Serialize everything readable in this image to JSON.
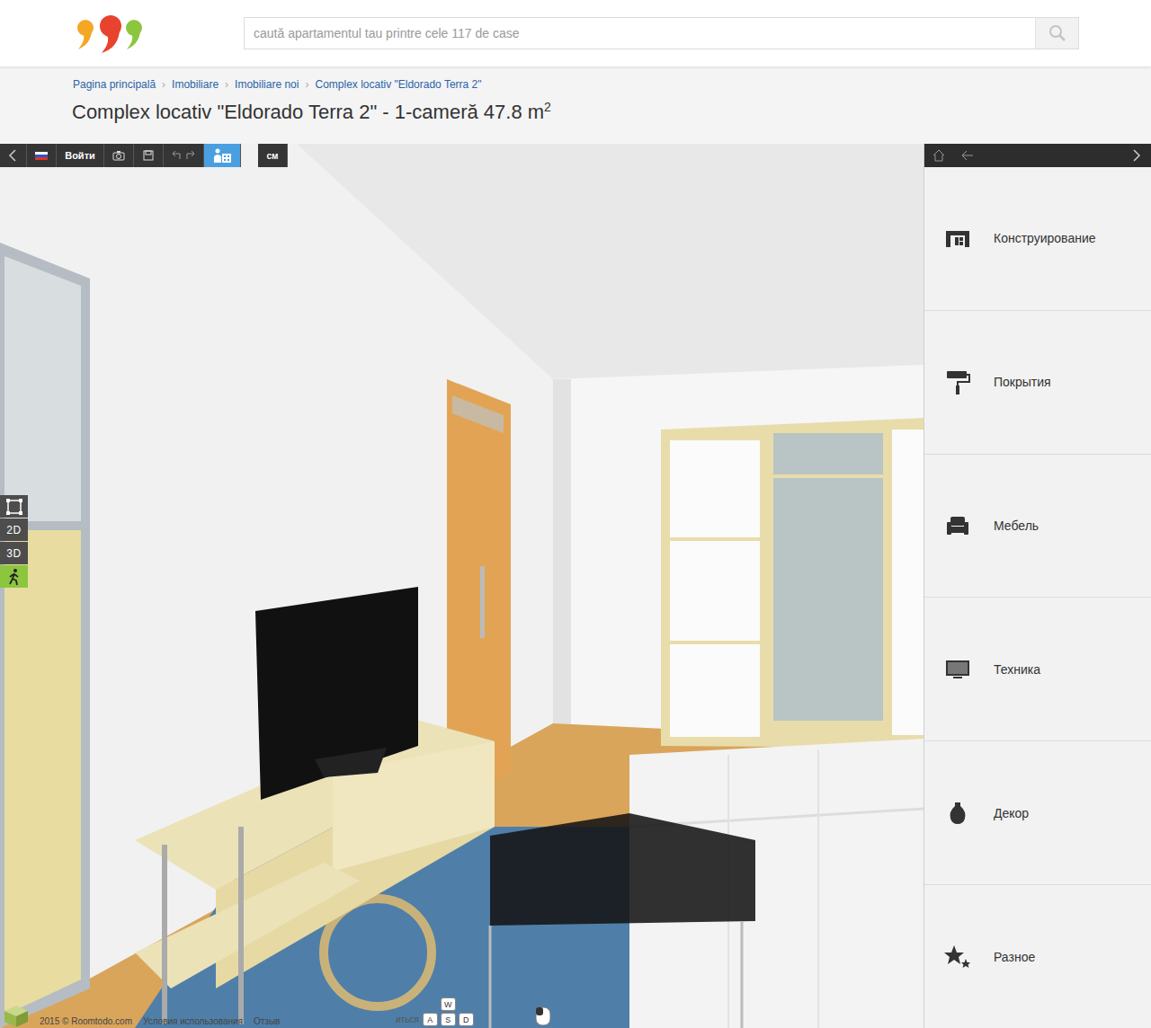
{
  "header": {
    "search": {
      "placeholder": "caută apartamentul tau printre cele 117 de case"
    }
  },
  "breadcrumbs": {
    "separator": "›",
    "items": [
      "Pagina principală",
      "Imobiliare",
      "Imobiliare noi",
      "Complex locativ \"Eldorado Terra 2\""
    ]
  },
  "page_title": {
    "text": "Complex locativ \"Eldorado Terra 2\" - 1-cameră 47.8 m",
    "superscript": "2"
  },
  "toolbar": {
    "items": [
      {
        "kind": "back",
        "selected": false
      },
      {
        "kind": "flag",
        "selected": false
      },
      {
        "kind": "text",
        "label": "Войти",
        "selected": false
      },
      {
        "kind": "camera",
        "selected": false
      },
      {
        "kind": "save",
        "selected": false
      },
      {
        "kind": "history",
        "selected": false
      },
      {
        "kind": "plan",
        "selected": true
      },
      {
        "kind": "units",
        "label": "см",
        "selected": false
      }
    ]
  },
  "view_modes": [
    {
      "kind": "select",
      "selected": false
    },
    {
      "kind": "text",
      "label": "2D",
      "selected": false
    },
    {
      "kind": "text",
      "label": "3D",
      "selected": false
    },
    {
      "kind": "walk",
      "selected": true
    }
  ],
  "side_panel": {
    "items": [
      {
        "label": "Конструирование"
      },
      {
        "label": "Покрытия"
      },
      {
        "label": "Мебель"
      },
      {
        "label": "Техника"
      },
      {
        "label": "Декор"
      },
      {
        "label": "Разное"
      }
    ]
  },
  "footer": {
    "copyright": "2015 © Roomtodo.com",
    "links": [
      "Условия использования",
      "Отзыв"
    ]
  },
  "controls_hint": {
    "text": "иться",
    "keys": [
      [
        "W"
      ],
      [
        "A",
        "S",
        "D"
      ]
    ]
  }
}
